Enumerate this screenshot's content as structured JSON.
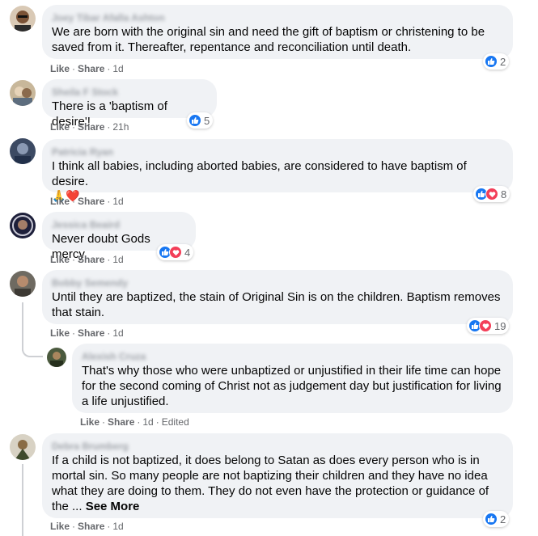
{
  "colors": {
    "bubble": "#f0f2f5",
    "like_blue": "#1877f2",
    "love_red": "#f33e58",
    "meta_gray": "#65676b"
  },
  "comments": [
    {
      "author": "Joey Tibar Afalla Ashton",
      "text": "We are born with the original sin and need the gift of baptism or christening to be saved from it. Thereafter, repentance and reconciliation until death.",
      "like_label": "Like",
      "share_label": "Share",
      "time": "1d",
      "reaction_count": "2",
      "reaction_icons": [
        "like-icon"
      ]
    },
    {
      "author": "Sheila F Stock",
      "text": "There is a 'baptism of desire'!",
      "like_label": "Like",
      "share_label": "Share",
      "time": "21h",
      "reaction_count": "5",
      "reaction_icons": [
        "like-icon"
      ]
    },
    {
      "author": "Patricia Ryan",
      "text": "I think all babies, including aborted babies, are considered to have baptism of desire.",
      "emoji": "🙏❤️",
      "like_label": "Like",
      "share_label": "Share",
      "time": "1d",
      "reaction_count": "8",
      "reaction_icons": [
        "like-icon",
        "love-icon"
      ]
    },
    {
      "author": "Jessica Beaird",
      "text": "Never doubt Gods mercy.",
      "like_label": "Like",
      "share_label": "Share",
      "time": "1d",
      "reaction_count": "4",
      "reaction_icons": [
        "like-icon",
        "love-icon"
      ]
    },
    {
      "author": "Bobby Semendy",
      "text": "Until they are baptized, the stain of Original Sin is on the children. Baptism removes that stain.",
      "like_label": "Like",
      "share_label": "Share",
      "time": "1d",
      "reaction_count": "19",
      "reaction_icons": [
        "like-icon",
        "love-icon"
      ]
    },
    {
      "author": "Alexish Cruza",
      "text": "That's why those who were unbaptized or unjustified in their life time can hope for the second coming of Christ not as judgement day but justification for living a life unjustified.",
      "like_label": "Like",
      "share_label": "Share",
      "time": "1d",
      "edited": "Edited"
    },
    {
      "author": "Debra Brumberg",
      "text": "If a child is not baptized, it does belong to Satan as does every person who is in mortal sin. So many people are not baptizing their children and they have no idea what they are doing to them. They do not even have the protection or guidance of the ...",
      "see_more": "See More",
      "like_label": "Like",
      "share_label": "Share",
      "time": "1d",
      "reaction_count": "2",
      "reaction_icons": [
        "like-icon"
      ]
    }
  ]
}
